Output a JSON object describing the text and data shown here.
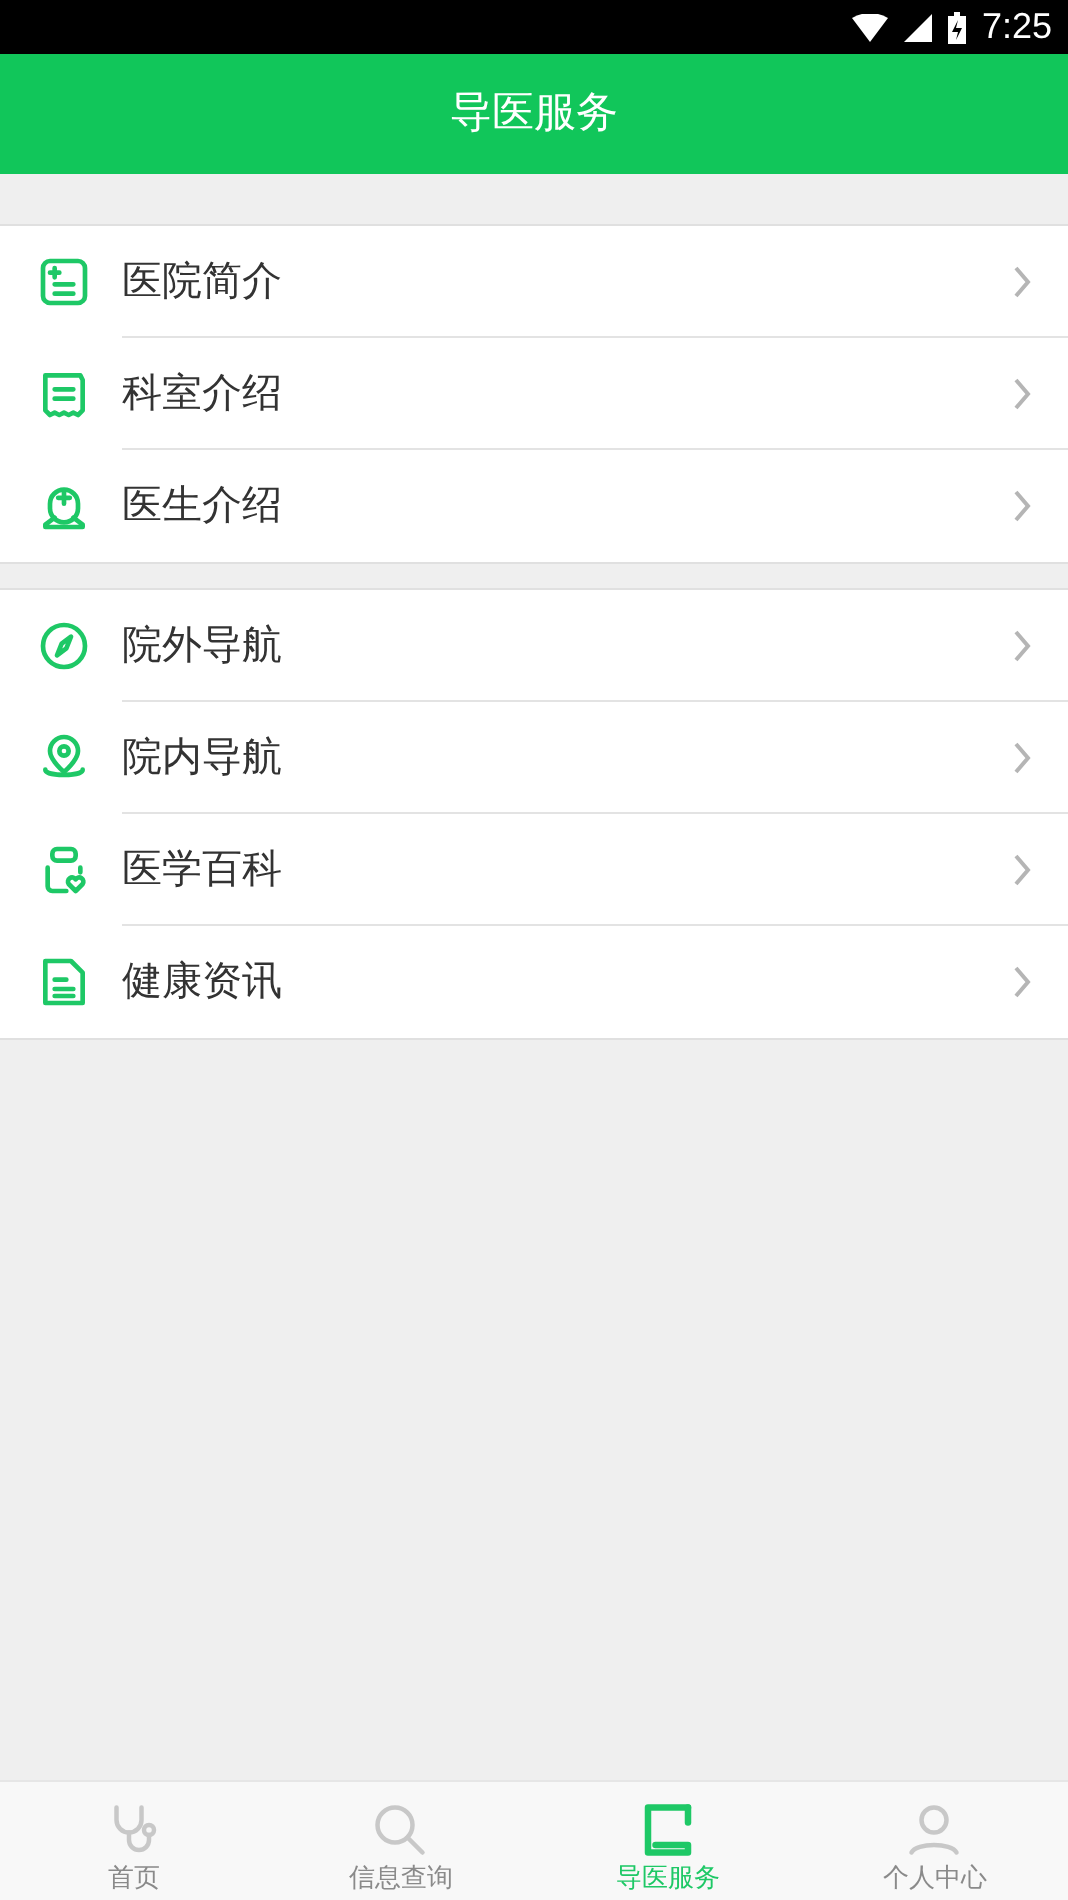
{
  "status_bar": {
    "time": "7:25"
  },
  "header": {
    "title": "导医服务"
  },
  "groups": [
    {
      "items": [
        {
          "label": "医院简介"
        },
        {
          "label": "科室介绍"
        },
        {
          "label": "医生介绍"
        }
      ]
    },
    {
      "items": [
        {
          "label": "院外导航"
        },
        {
          "label": "院内导航"
        },
        {
          "label": "医学百科"
        },
        {
          "label": "健康资讯"
        }
      ]
    }
  ],
  "tabs": [
    {
      "label": "首页",
      "selected": false
    },
    {
      "label": "信息查询",
      "selected": false
    },
    {
      "label": "导医服务",
      "selected": true
    },
    {
      "label": "个人中心",
      "selected": false
    }
  ]
}
